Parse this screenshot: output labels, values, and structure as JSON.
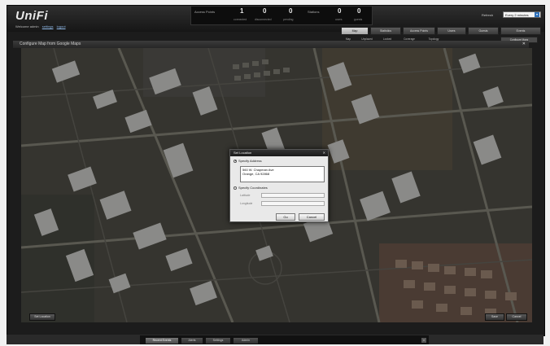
{
  "app": {
    "logo": "UniFi",
    "welcome": "Welcome admin",
    "welcome_links": [
      "settings",
      "logout"
    ]
  },
  "stats": {
    "access_points_label": "Access Points",
    "stations_label": "Stations",
    "ap_values": [
      {
        "value": "1",
        "label": "connected"
      },
      {
        "value": "0",
        "label": "disconnected"
      },
      {
        "value": "0",
        "label": "pending"
      }
    ],
    "sta_values": [
      {
        "value": "0",
        "label": "users"
      },
      {
        "value": "0",
        "label": "guests"
      }
    ]
  },
  "refresh": {
    "label": "Refresh",
    "value": "Every 2 minutes"
  },
  "tabs": [
    "Map",
    "Statistics",
    "Access Points",
    "Users",
    "Guests",
    "Events"
  ],
  "subtabs": [
    "Map",
    "Unplaced",
    "Locked",
    "Coverage",
    "Topology"
  ],
  "subtab_buttons": [
    "Configure Maps"
  ],
  "map_panel": {
    "title": "Configure Map from Google Maps",
    "close_icon": "close-icon",
    "buttons": {
      "set_location": "Set Location",
      "save": "Save",
      "cancel": "Cancel"
    }
  },
  "dialog": {
    "title": "Set Location",
    "opt_address": "Specify Address",
    "address_line1": "560 W. Chapman Ave",
    "address_line2": "Orange, CA 92868",
    "opt_coords": "Specify Coordinates",
    "latitude_label": "Latitude",
    "longitude_label": "Longitude",
    "latitude_value": "",
    "longitude_value": "",
    "ok": "Go",
    "cancel": "Cancel"
  },
  "bottom_tabs": [
    "Recent Events",
    "Alerts",
    "Settings",
    "Admin"
  ],
  "colors": {
    "accent": "#2d6fb8",
    "frame": "#1c1c1c"
  }
}
